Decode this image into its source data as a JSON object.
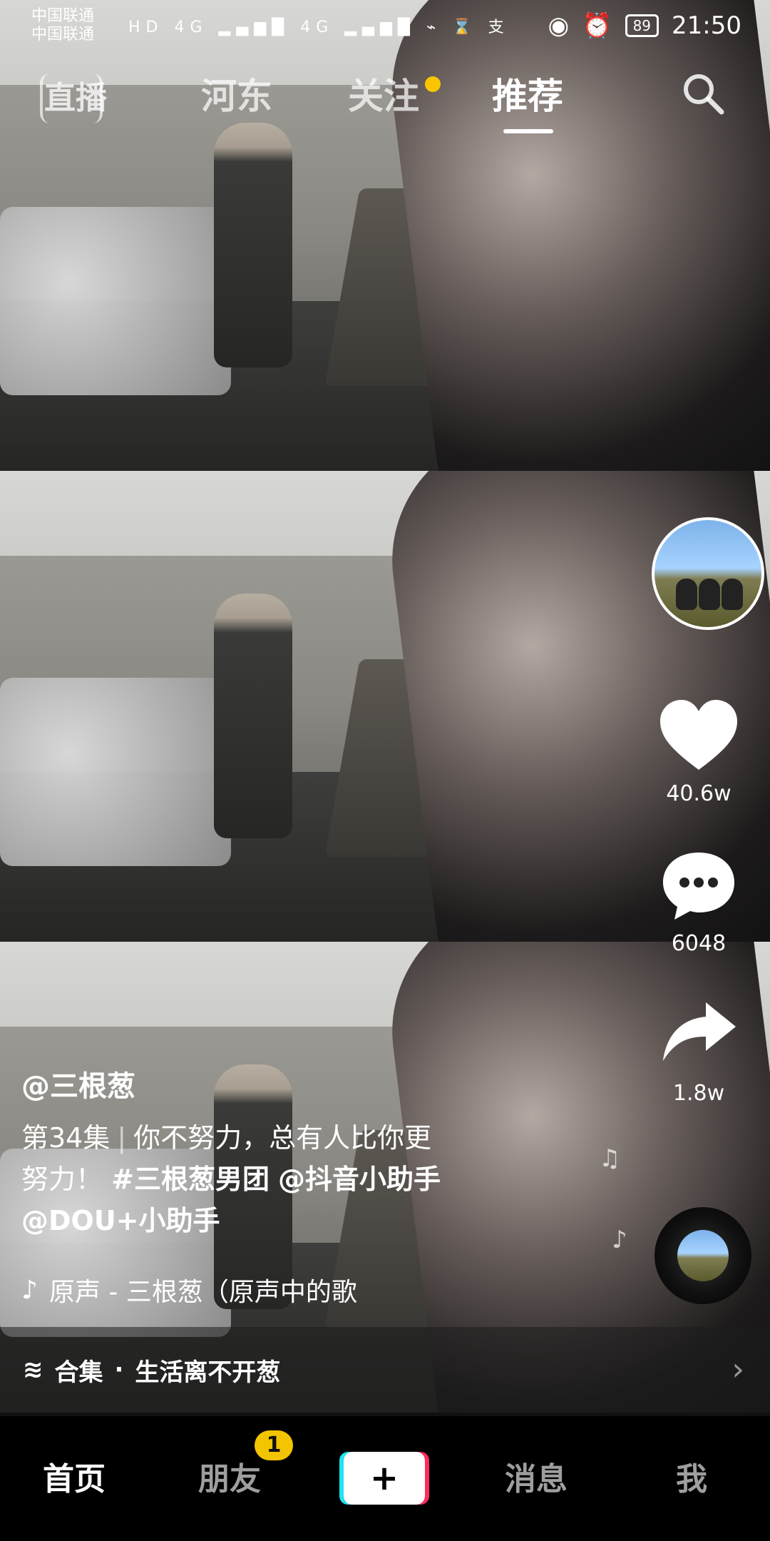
{
  "status_bar": {
    "carrier_1": "中国联通",
    "carrier_2": "中国联通",
    "hd": "HD",
    "signal_label_1": "4G",
    "signal_label_2": "4G",
    "battery": "89",
    "time": "21:50"
  },
  "top_tabs": {
    "live": "直播",
    "hedong": "河东",
    "follow": "关注",
    "recommend": "推荐"
  },
  "video": {
    "author": "@三根葱",
    "episode": "第34集",
    "separator": "|",
    "desc_1": "你不努力，总有人比你更",
    "desc_2": "努力！",
    "hashtag": "#三根葱男团",
    "mention_1": "@抖音小助手",
    "mention_2": "@DOU+小助手",
    "music": "原声 - 三根葱（原声中的歌"
  },
  "actions": {
    "likes": "40.6w",
    "comments": "6048",
    "shares": "1.8w"
  },
  "collection": {
    "label": "合集",
    "dot": "·",
    "title": "生活离不开葱"
  },
  "bottom_nav": {
    "home": "首页",
    "friends": "朋友",
    "friends_badge": "1",
    "messages": "消息",
    "me": "我",
    "create": "+"
  },
  "icons": {
    "search": "search-icon",
    "heart": "heart-icon",
    "comment": "comment-icon",
    "share": "share-icon",
    "music": "music-icon",
    "collection": "layers-icon",
    "chevron": "chevron-right-icon"
  },
  "colors": {
    "accent_yellow": "#f3c400",
    "tiktok_cyan": "#1fe3f0",
    "tiktok_pink": "#ff2b5f"
  }
}
